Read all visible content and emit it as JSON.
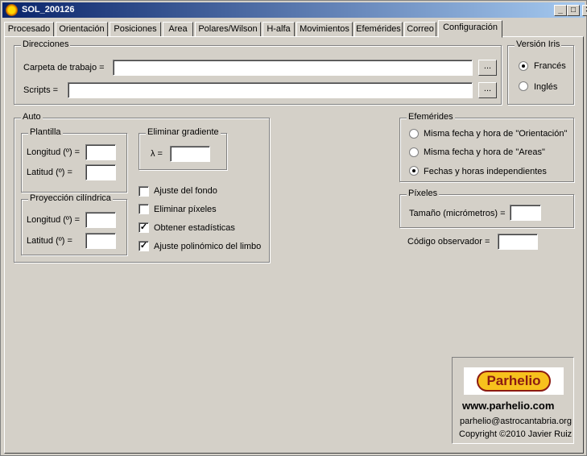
{
  "window": {
    "title": "SOL_200126",
    "minimize_glyph": "_",
    "maximize_glyph": "□",
    "close_glyph": "✕"
  },
  "tabs": [
    {
      "label": "Procesado"
    },
    {
      "label": "Orientación"
    },
    {
      "label": "Posiciones"
    },
    {
      "label": "Area"
    },
    {
      "label": "Polares/Wilson"
    },
    {
      "label": "H-alfa"
    },
    {
      "label": "Movimientos"
    },
    {
      "label": "Efemérides"
    },
    {
      "label": "Correo"
    },
    {
      "label": "Configuración",
      "active": true
    }
  ],
  "direcciones": {
    "legend": "Direcciones",
    "carpeta_label": "Carpeta de trabajo =",
    "carpeta_value": "",
    "scripts_label": "Scripts =",
    "scripts_value": "",
    "browse_label": "..."
  },
  "version_iris": {
    "legend": "Versión Iris",
    "options": [
      {
        "label": "Francés",
        "selected": true
      },
      {
        "label": "Inglés",
        "selected": false
      }
    ]
  },
  "auto": {
    "legend": "Auto",
    "plantilla": {
      "legend": "Plantilla",
      "longitud_label": "Longitud (º) =",
      "longitud_value": "",
      "latitud_label": "Latitud (º) =",
      "latitud_value": ""
    },
    "eliminar_gradiente": {
      "legend": "Eliminar gradiente",
      "lambda_label": "λ =",
      "lambda_value": ""
    },
    "proyeccion": {
      "legend": "Proyección cilíndrica",
      "longitud_label": "Longitud (º) =",
      "longitud_value": "",
      "latitud_label": "Latitud (º) =",
      "latitud_value": ""
    },
    "checks": [
      {
        "label": "Ajuste del fondo",
        "checked": false
      },
      {
        "label": "Eliminar píxeles",
        "checked": false
      },
      {
        "label": "Obtener estadísticas",
        "checked": true
      },
      {
        "label": "Ajuste polinómico del limbo",
        "checked": true
      }
    ]
  },
  "efemerides": {
    "legend": "Efemérides",
    "options": [
      {
        "label": "Misma fecha y hora de \"Orientación\"",
        "selected": false
      },
      {
        "label": "Misma fecha y hora de \"Areas\"",
        "selected": false
      },
      {
        "label": "Fechas y horas independientes",
        "selected": true
      }
    ]
  },
  "pixeles": {
    "legend": "Píxeles",
    "tamano_label": "Tamaño (micrómetros) =",
    "tamano_value": ""
  },
  "codigo": {
    "label": "Código observador =",
    "value": ""
  },
  "about": {
    "logo_text": "Parhelio",
    "website": "www.parhelio.com",
    "email": "parhelio@astrocantabria.org",
    "copyright": "Copyright ©2010 Javier Ruiz"
  },
  "colors": {
    "window_bg": "#d4d0c8",
    "title_gradient_start": "#0a246a",
    "title_gradient_end": "#a6caf0",
    "logo_fill": "#f7c11d",
    "logo_stroke": "#8b1b12"
  }
}
